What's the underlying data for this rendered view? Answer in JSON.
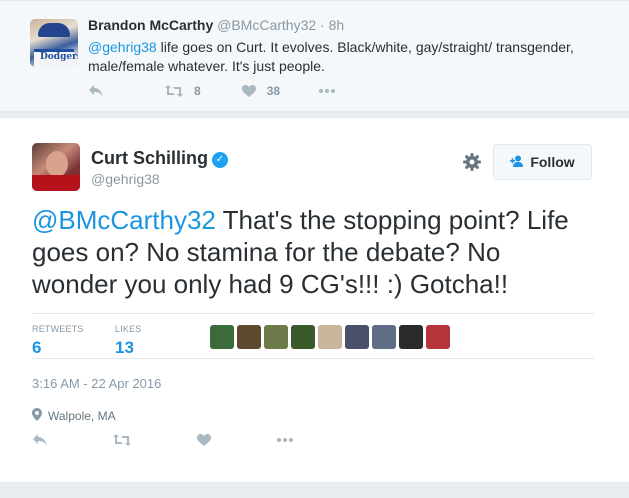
{
  "reply": {
    "name": "Brandon McCarthy",
    "handle": "@BMcCarthy32",
    "separator": "·",
    "time": "8h",
    "mention": "@gehrig38",
    "text": " life goes on Curt. It evolves. Black/white, gay/straight/ transgender, male/female whatever. It's just people.",
    "retweet_count": "8",
    "like_count": "38"
  },
  "tweet": {
    "name": "Curt Schilling",
    "handle": "@gehrig38",
    "follow_label": "Follow",
    "mention": "@BMcCarthy32",
    "text": " That's the stopping point? Life goes on? No stamina for the debate? No wonder you only had 9 CG's!!! :) Gotcha!!",
    "retweets_label": "RETWEETS",
    "retweets_count": "6",
    "likes_label": "LIKES",
    "likes_count": "13",
    "timestamp": "3:16 AM - 22 Apr 2016",
    "location": "Walpole, MA"
  },
  "icons": {
    "reply": "reply-icon",
    "retweet": "retweet-icon",
    "like": "heart-icon",
    "more": "more-icon",
    "verified": "verified-badge-icon",
    "gear": "gear-icon",
    "follow": "add-user-icon",
    "location": "map-pin-icon"
  },
  "liker_colors": [
    "#3b6b3a",
    "#5d4a2e",
    "#6c7a4a",
    "#3a5a2a",
    "#c9b59a",
    "#4a4f6a",
    "#5f6e84",
    "#2a2a2a",
    "#b3343a"
  ],
  "colors": {
    "link": "#1b95e0",
    "muted": "#8899a6",
    "verified": "#1da1f2"
  }
}
